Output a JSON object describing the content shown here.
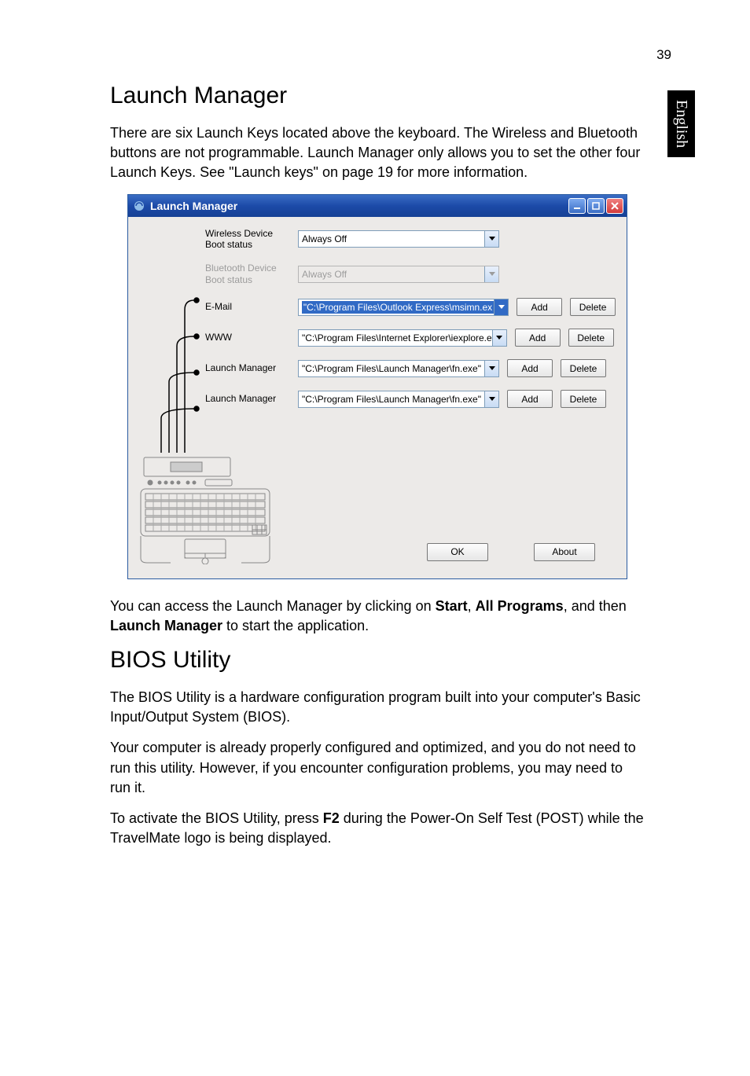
{
  "page_number": "39",
  "side_tab": "English",
  "section1": {
    "heading": "Launch Manager",
    "para1": "There are six Launch Keys located above the keyboard. The Wireless and Bluetooth buttons are not programmable. Launch Manager only allows you to set the other four Launch Keys. See \"Launch keys\" on page 19 for more information.",
    "para2_pre": "You can access the Launch Manager by clicking on ",
    "para2_b1": "Start",
    "para2_mid1": ", ",
    "para2_b2": "All Programs",
    "para2_mid2": ", and then ",
    "para2_b3": "Launch Manager",
    "para2_post": " to start the application."
  },
  "window": {
    "title": "Launch Manager",
    "rows": {
      "wireless": {
        "label": "Wireless Device Boot status",
        "value": "Always Off"
      },
      "bluetooth": {
        "label": "Bluetooth Device Boot status",
        "value": "Always Off"
      },
      "email": {
        "label": "E-Mail",
        "value": "\"C:\\Program Files\\Outlook Express\\msimn.ex"
      },
      "www": {
        "label": "WWW",
        "value": "\"C:\\Program Files\\Internet Explorer\\iexplore.e"
      },
      "lm1": {
        "label": "Launch Manager",
        "value": "\"C:\\Program Files\\Launch Manager\\fn.exe\""
      },
      "lm2": {
        "label": "Launch Manager",
        "value": "\"C:\\Program Files\\Launch Manager\\fn.exe\""
      }
    },
    "buttons": {
      "add": "Add",
      "delete": "Delete",
      "ok": "OK",
      "about": "About"
    }
  },
  "section2": {
    "heading": "BIOS Utility",
    "para1": "The BIOS Utility is a hardware configuration program built into your computer's Basic Input/Output System (BIOS).",
    "para2": "Your computer is already properly configured and optimized, and you do not need to run this utility. However, if you encounter configuration problems, you may need to run it.",
    "para3_pre": "To activate the BIOS Utility, press ",
    "para3_b1": "F2",
    "para3_post": " during the Power-On Self Test (POST) while the TravelMate logo is being displayed."
  }
}
